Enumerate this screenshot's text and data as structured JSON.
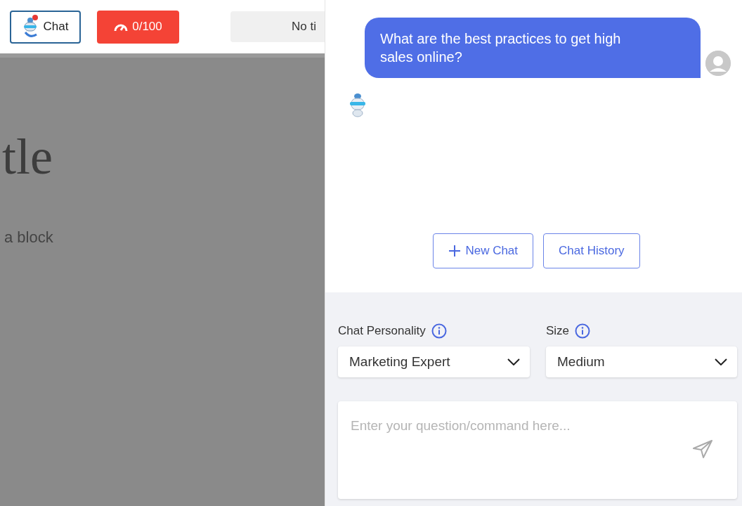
{
  "toolbar": {
    "chat_button": "Chat",
    "usage_button": "0/100",
    "title_field": "No ti"
  },
  "page_preview": {
    "heading": "tle",
    "text": "a block"
  },
  "chat": {
    "messages": [
      {
        "kind": "user",
        "text": "What are the best practices to get high sales online?"
      },
      {
        "kind": "bot"
      }
    ],
    "actions": [
      {
        "kind": "new",
        "label": "New Chat"
      },
      {
        "kind": "history",
        "label": "Chat History"
      }
    ],
    "settings": [
      {
        "label": "Chat Personality",
        "value": "Marketing Expert"
      },
      {
        "label": "Size",
        "value": "Medium"
      }
    ],
    "input": {
      "placeholder": "Enter your question/command here..."
    }
  }
}
